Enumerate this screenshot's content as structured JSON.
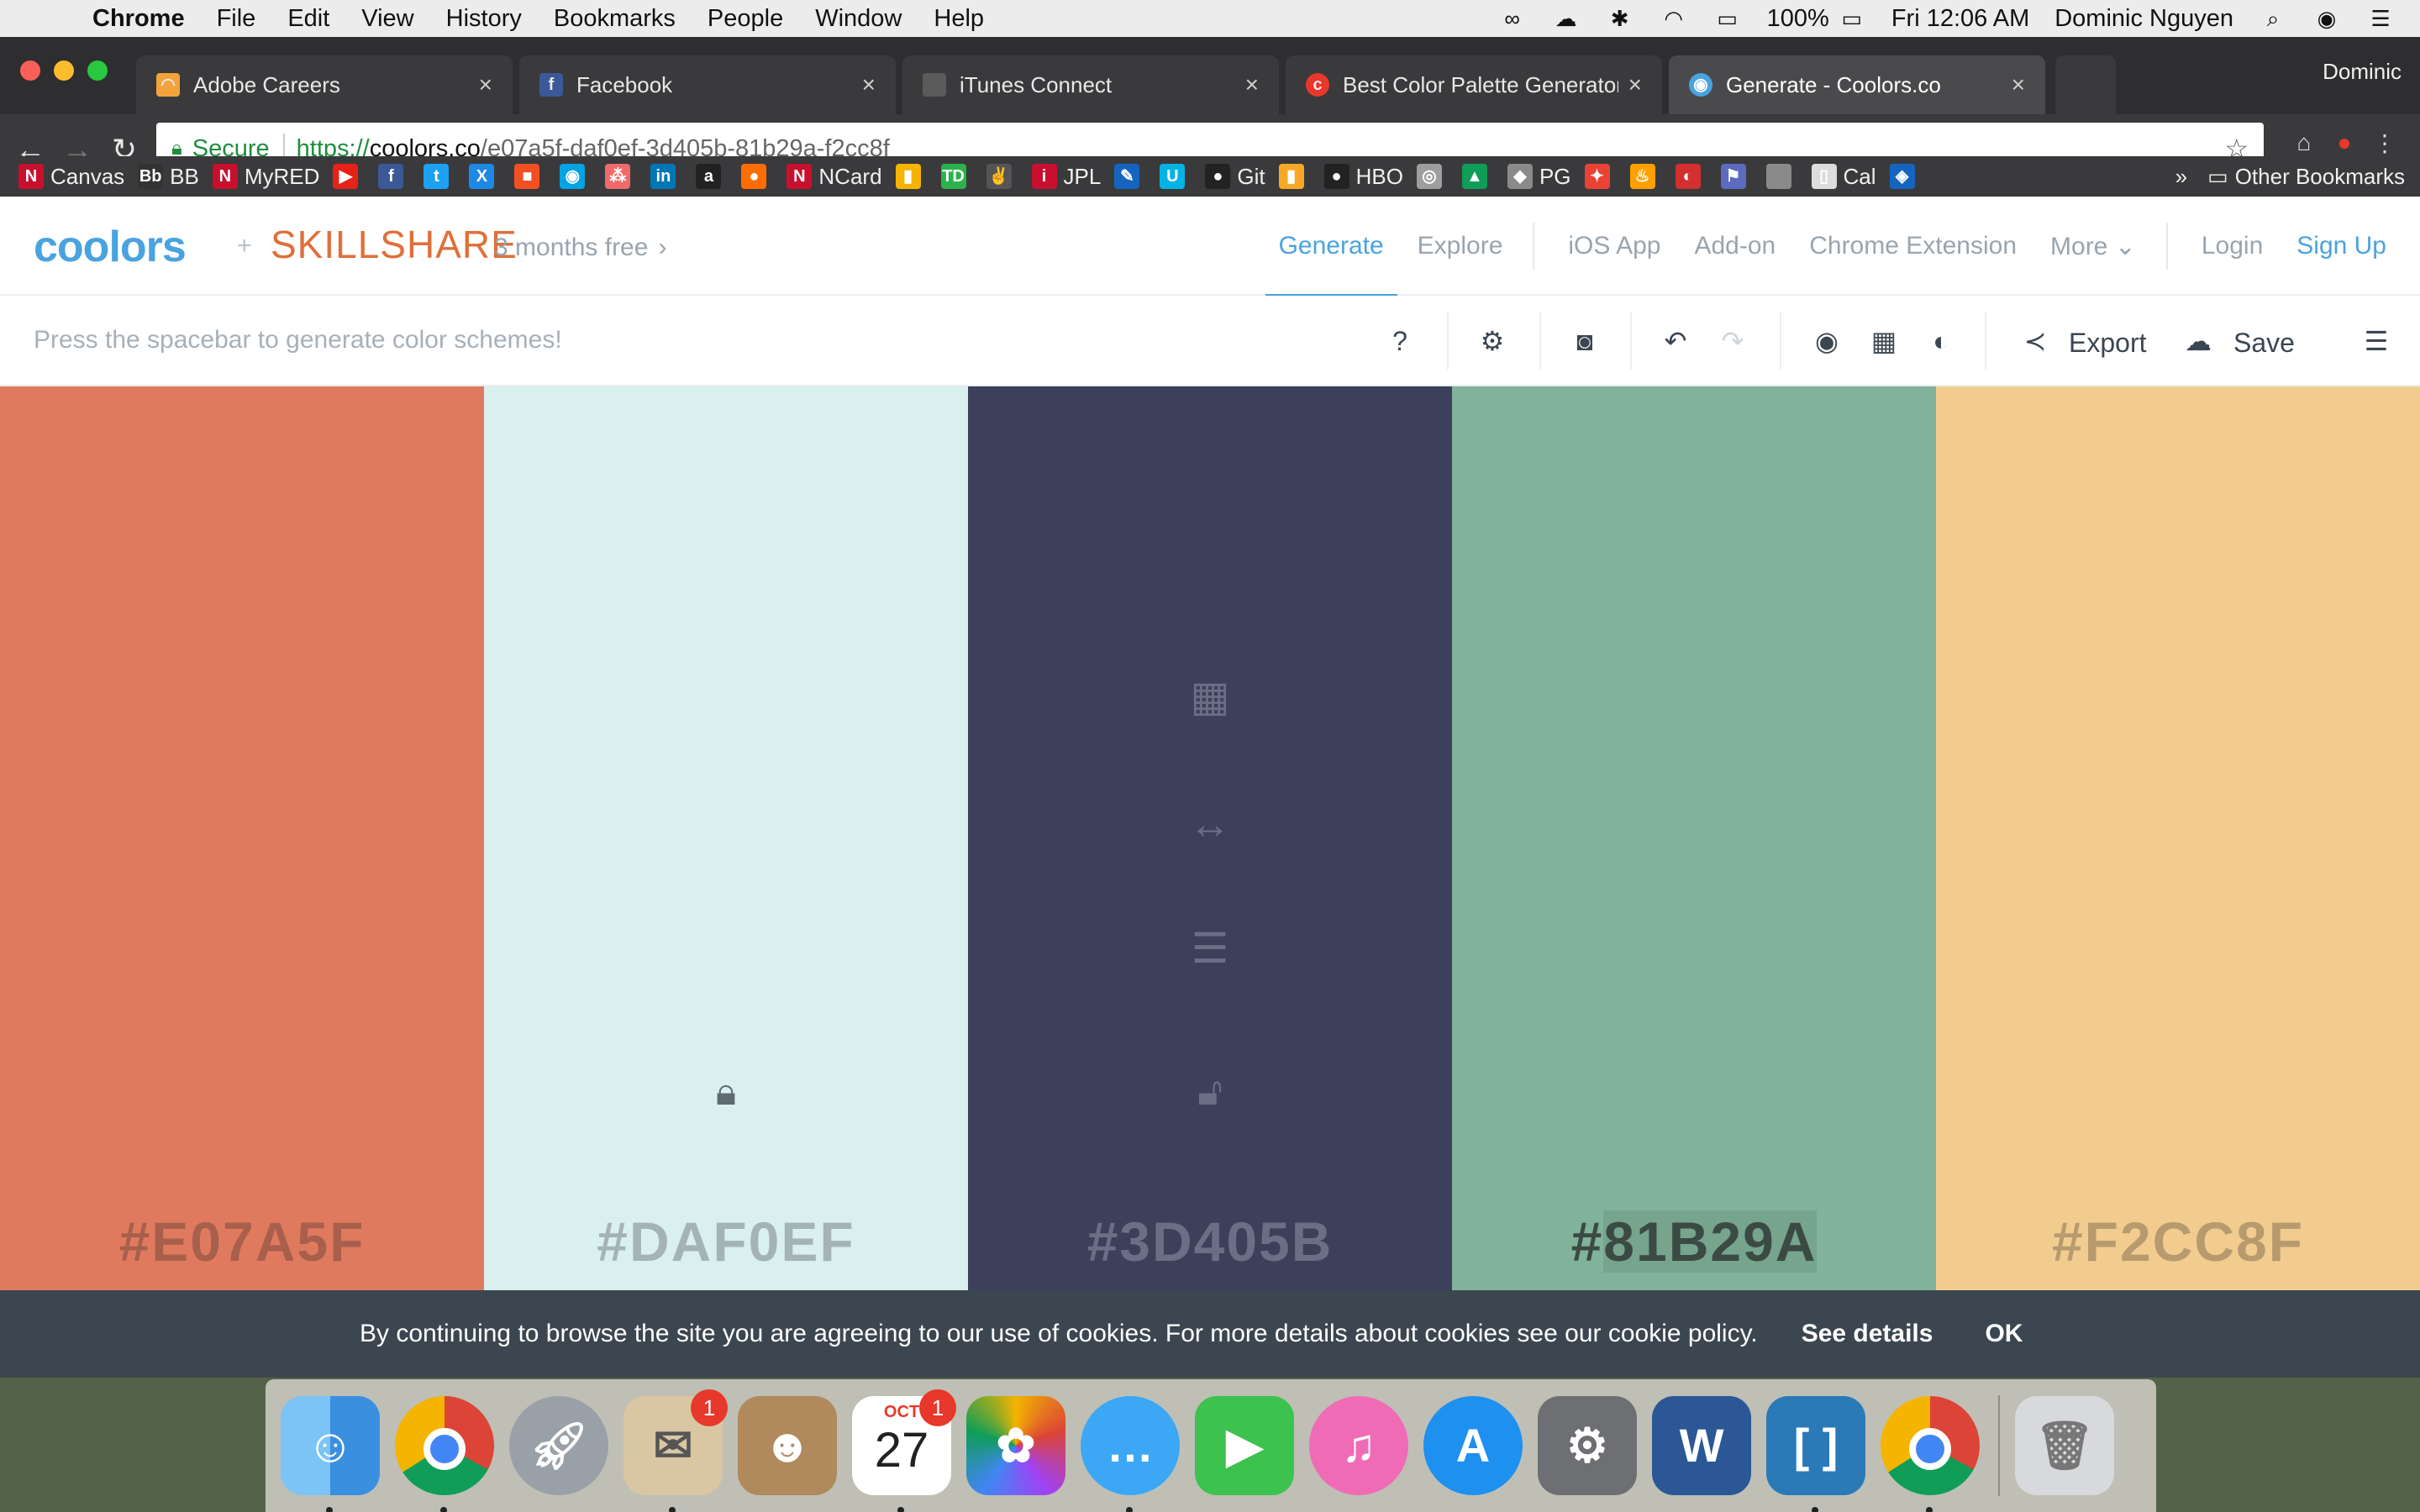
{
  "menubar": {
    "app": "Chrome",
    "items": [
      "File",
      "Edit",
      "View",
      "History",
      "Bookmarks",
      "People",
      "Window",
      "Help"
    ],
    "battery": "100%",
    "clock": "Fri 12:06 AM",
    "user": "Dominic Nguyen"
  },
  "tabs": [
    {
      "label": "Adobe Careers",
      "icon": "adobe-icon",
      "color": "#f2a33a"
    },
    {
      "label": "Facebook",
      "icon": "facebook-icon",
      "color": "#3b5998"
    },
    {
      "label": "iTunes Connect",
      "icon": "apple-icon",
      "color": "#8a8a8a"
    },
    {
      "label": "Best Color Palette Generators",
      "icon": "red-c-icon",
      "color": "#e8372b"
    },
    {
      "label": "Generate - Coolors.co",
      "icon": "coolors-icon",
      "color": "#4aa3df"
    }
  ],
  "profile": "Dominic",
  "omnibox": {
    "secure": "Secure",
    "scheme": "https://",
    "host": "coolors.co",
    "path": "/e07a5f-daf0ef-3d405b-81b29a-f2cc8f"
  },
  "bookmarks": [
    {
      "label": "Canvas",
      "color": "#c8102e",
      "glyph": "N"
    },
    {
      "label": "BB",
      "color": "#333333",
      "glyph": "Bb"
    },
    {
      "label": "MyRED",
      "color": "#c8102e",
      "glyph": "N"
    },
    {
      "label": "",
      "color": "#e62117",
      "glyph": "▶"
    },
    {
      "label": "",
      "color": "#3b5998",
      "glyph": "f"
    },
    {
      "label": "",
      "color": "#1da1f2",
      "glyph": "t"
    },
    {
      "label": "",
      "color": "#1e88e5",
      "glyph": "X"
    },
    {
      "label": "",
      "color": "#f25022",
      "glyph": "■"
    },
    {
      "label": "",
      "color": "#00a4e4",
      "glyph": "◉"
    },
    {
      "label": "",
      "color": "#f06a6a",
      "glyph": "⁂"
    },
    {
      "label": "",
      "color": "#0077b5",
      "glyph": "in"
    },
    {
      "label": "",
      "color": "#222222",
      "glyph": "a"
    },
    {
      "label": "",
      "color": "#ff6d00",
      "glyph": "●"
    },
    {
      "label": "NCard",
      "color": "#c8102e",
      "glyph": "N"
    },
    {
      "label": "",
      "color": "#f4b400",
      "glyph": "▮"
    },
    {
      "label": "",
      "color": "#2bb24c",
      "glyph": "TD"
    },
    {
      "label": "",
      "color": "#555555",
      "glyph": "✌"
    },
    {
      "label": "JPL",
      "color": "#c8102e",
      "glyph": "i"
    },
    {
      "label": "",
      "color": "#1565c0",
      "glyph": "✎"
    },
    {
      "label": "",
      "color": "#02b3e4",
      "glyph": "U"
    },
    {
      "label": "Git",
      "color": "#222222",
      "glyph": "●"
    },
    {
      "label": "",
      "color": "#f9a825",
      "glyph": "▮"
    },
    {
      "label": "HBO",
      "color": "#222222",
      "glyph": "●"
    },
    {
      "label": "",
      "color": "#9e9e9e",
      "glyph": "◎"
    },
    {
      "label": "",
      "color": "#0f9d58",
      "glyph": "▲"
    },
    {
      "label": "PG",
      "color": "#8a8a8a",
      "glyph": "◆"
    },
    {
      "label": "",
      "color": "#ea4335",
      "glyph": "✦"
    },
    {
      "label": "",
      "color": "#ffa000",
      "glyph": "♨"
    },
    {
      "label": "",
      "color": "#d32f2f",
      "glyph": "◐"
    },
    {
      "label": "",
      "color": "#5c6bc0",
      "glyph": "⚑"
    },
    {
      "label": "",
      "color": "#8a8a8a",
      "glyph": ""
    },
    {
      "label": "Cal",
      "color": "#dddddd",
      "glyph": "▯"
    },
    {
      "label": "",
      "color": "#1565c0",
      "glyph": "◈"
    }
  ],
  "other_bookmarks": "Other Bookmarks",
  "site": {
    "logo": "coolors",
    "plus": "+",
    "partner": "SKILLSHARE",
    "promo": "3 months free",
    "nav": {
      "generate": "Generate",
      "explore": "Explore",
      "ios": "iOS App",
      "addon": "Add-on",
      "chrome_ext": "Chrome Extension",
      "more": "More",
      "login": "Login",
      "signup": "Sign Up"
    },
    "hint": "Press the spacebar to generate color schemes!",
    "export": "Export",
    "save": "Save"
  },
  "palette": [
    {
      "hex": "#E07A5F",
      "bg": "#e07a5f",
      "text": "#a85f4c",
      "locked": false
    },
    {
      "hex": "#DAF0EF",
      "bg": "#daf0ef",
      "text": "#a4b4b4",
      "locked": true
    },
    {
      "hex": "#3D405B",
      "bg": "#3d405b",
      "text": "#6b6e85",
      "locked": true
    },
    {
      "hex_prefix": "#",
      "hex_selected": "81B29A",
      "bg": "#81b29a",
      "text": "#3c4a44",
      "locked": false
    },
    {
      "hex": "#F2CC8F",
      "bg": "#f2cc8f",
      "text": "#b79b6f",
      "locked": false
    }
  ],
  "cookie": {
    "text": "By continuing to browse the site you are agreeing to our use of cookies. For more details about cookies see our cookie policy.",
    "details": "See details",
    "ok": "OK"
  },
  "dock": {
    "mail_badge": "1",
    "calendar_month": "OCT",
    "calendar_day": "27",
    "calendar_badge": "1"
  }
}
